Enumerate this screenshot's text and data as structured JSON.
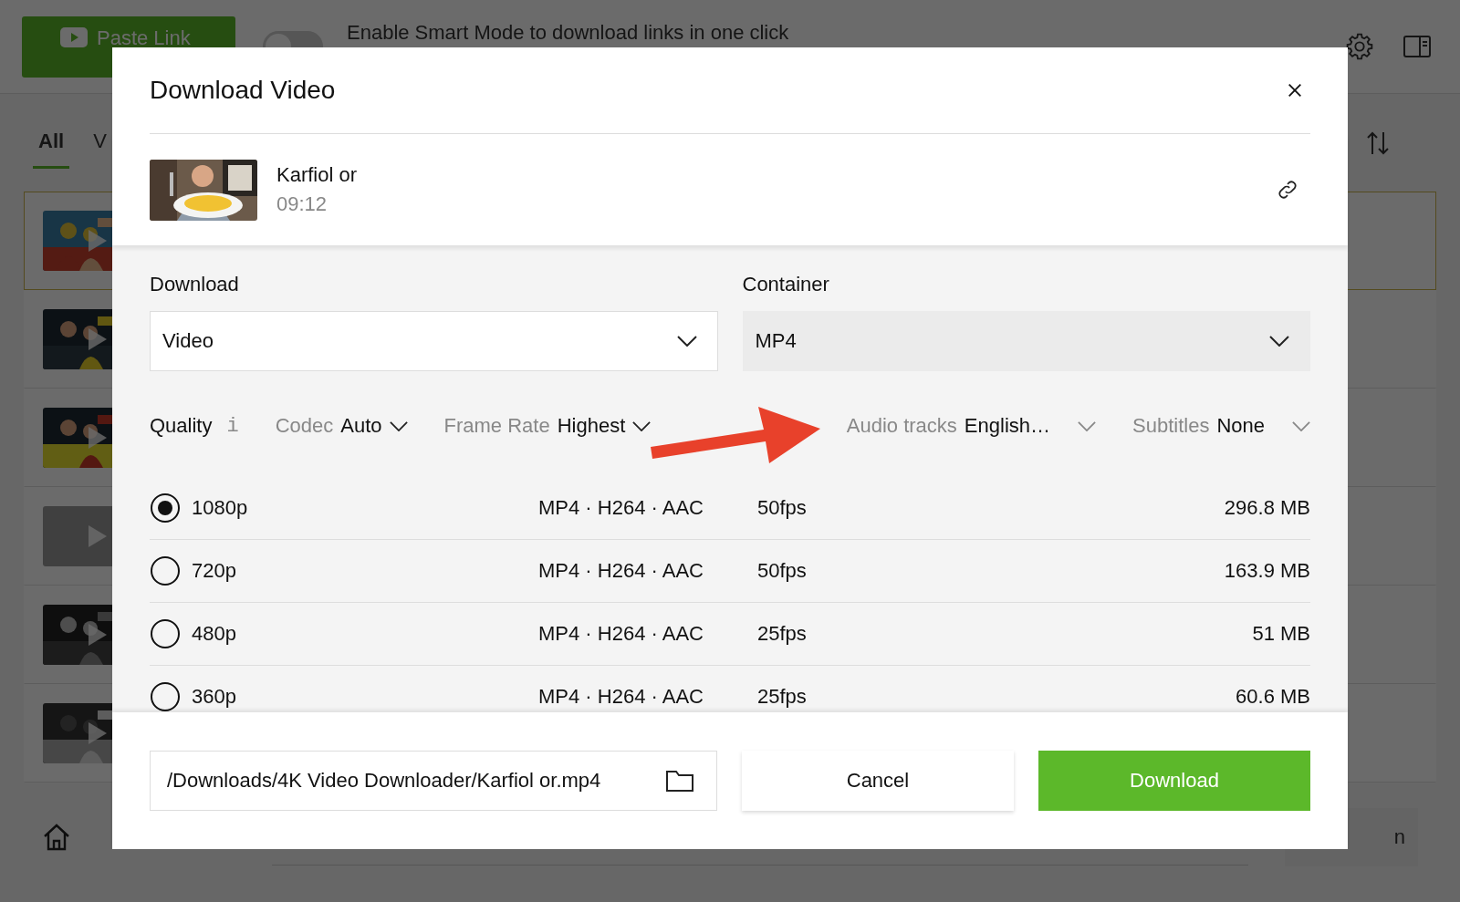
{
  "app": {
    "paste_button": "Paste Link",
    "smart_mode": {
      "on": false,
      "label": "Enable Smart Mode to download links in one click"
    },
    "tabs": [
      {
        "label": "All",
        "selected": true
      },
      {
        "label": "V",
        "selected": false
      }
    ],
    "items": [
      {
        "kind": "picture",
        "selected": true
      },
      {
        "kind": "picture",
        "selected": false
      },
      {
        "kind": "picture",
        "selected": false
      },
      {
        "kind": "placeholder",
        "selected": false
      },
      {
        "kind": "picture",
        "selected": false
      },
      {
        "kind": "picture",
        "selected": false
      }
    ],
    "bottom_button": "n"
  },
  "dialog": {
    "title": "Download Video",
    "video": {
      "title": "Karfiol or",
      "duration": "09:12"
    },
    "selects": [
      {
        "label": "Download",
        "value": "Video",
        "hovered": false
      },
      {
        "label": "Container",
        "value": "MP4",
        "hovered": true
      }
    ],
    "filters": [
      {
        "kind": "info",
        "label": "Quality",
        "icon": "i"
      },
      {
        "kind": "select",
        "label": "Codec",
        "value": "Auto"
      },
      {
        "kind": "select",
        "label": "Frame Rate",
        "value": "Highest"
      },
      {
        "kind": "select",
        "label": "Audio tracks",
        "value": "English…"
      },
      {
        "kind": "select",
        "label": "Subtitles",
        "value": "None"
      }
    ],
    "rows": [
      {
        "resolution": "1080p",
        "format": "MP4 · H264 · AAC",
        "fps": "50fps",
        "size": "296.8 MB",
        "selected": true
      },
      {
        "resolution": "720p",
        "format": "MP4 · H264 · AAC",
        "fps": "50fps",
        "size": "163.9 MB",
        "selected": false
      },
      {
        "resolution": "480p",
        "format": "MP4 · H264 · AAC",
        "fps": "25fps",
        "size": "51 MB",
        "selected": false
      },
      {
        "resolution": "360p",
        "format": "MP4 · H264 · AAC",
        "fps": "25fps",
        "size": "60.6 MB",
        "selected": false
      }
    ],
    "path": "/Downloads/4K Video Downloader/Karfiol or.mp4",
    "buttons": {
      "cancel": "Cancel",
      "download": "Download"
    }
  }
}
